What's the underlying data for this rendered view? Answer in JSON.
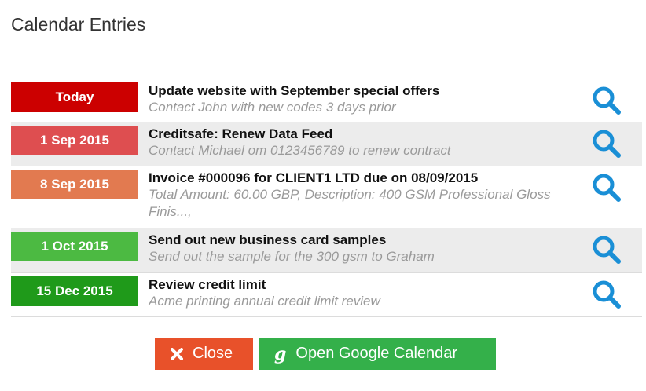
{
  "dialog": {
    "title": "Calendar Entries"
  },
  "entries": [
    {
      "date": "Today",
      "badge_color": "#cc0000",
      "title": "Update website with September special offers",
      "description": "Contact John with new codes 3 days prior",
      "icon": "search-icon"
    },
    {
      "date": "1 Sep 2015",
      "badge_color": "#de4e50",
      "title": "Creditsafe: Renew Data Feed",
      "description": "Contact Michael om 0123456789 to renew contract",
      "icon": "search-icon"
    },
    {
      "date": "8 Sep 2015",
      "badge_color": "#e27a50",
      "title": "Invoice #000096 for CLIENT1 LTD due on 08/09/2015",
      "description": "Total Amount: 60.00 GBP, Description: 400 GSM Professional Gloss Finis...,",
      "icon": "search-icon"
    },
    {
      "date": "1 Oct 2015",
      "badge_color": "#4cba42",
      "title": "Send out new business card samples",
      "description": "Send out the sample for the 300 gsm to Graham",
      "icon": "search-icon"
    },
    {
      "date": "15 Dec 2015",
      "badge_color": "#1f9a1a",
      "title": "Review credit limit",
      "description": "Acme printing annual credit limit review",
      "icon": "search-icon"
    }
  ],
  "footer": {
    "close_label": "Close",
    "google_label": "Open Google Calendar",
    "google_glyph": "g"
  },
  "colors": {
    "accent_icon": "#1a8fd6",
    "close_button": "#e8512a",
    "google_button": "#34b04a"
  }
}
